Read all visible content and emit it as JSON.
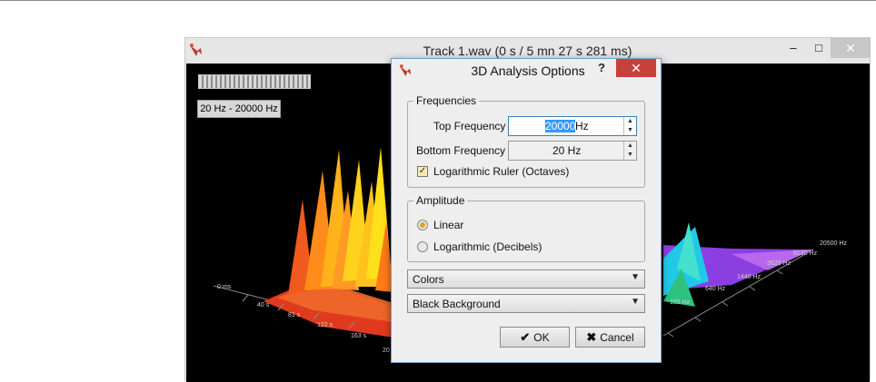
{
  "main_window": {
    "title": "Track 1.wav (0 s / 5 mn 27 s 281 ms)",
    "controls": {
      "minimize": "–",
      "maximize": "□",
      "close": "✕"
    },
    "range_button": "20 Hz - 20000 Hz",
    "time_axis": [
      "0 ms",
      "40 s",
      "81 s",
      "122 s",
      "163 s",
      "20"
    ],
    "freq_axis": [
      "20500 Hz",
      "9130 Hz",
      "3620 Hz",
      "1440 Hz",
      "640 Hz",
      "155 Hz"
    ]
  },
  "dialog": {
    "title": "3D Analysis Options",
    "help": "?",
    "close": "✕",
    "frequencies": {
      "legend": "Frequencies",
      "top_label": "Top Frequency",
      "top_value": "20000",
      "top_unit": "Hz",
      "bottom_label": "Bottom Frequency",
      "bottom_value": "20 Hz",
      "log_ruler_label": "Logarithmic Ruler (Octaves)",
      "log_ruler_checked": true
    },
    "amplitude": {
      "legend": "Amplitude",
      "linear_label": "Linear",
      "log_label": "Logarithmic (Decibels)",
      "selected": "Linear"
    },
    "color_mode": "Colors",
    "background": "Black Background",
    "ok_label": "OK",
    "ok_icon": "check-icon",
    "cancel_label": "Cancel",
    "cancel_icon": "x-icon"
  },
  "colors": {
    "accent": "#3399ff",
    "close_red": "#c7403a",
    "checkbox_fill": "#f7e9b0"
  }
}
